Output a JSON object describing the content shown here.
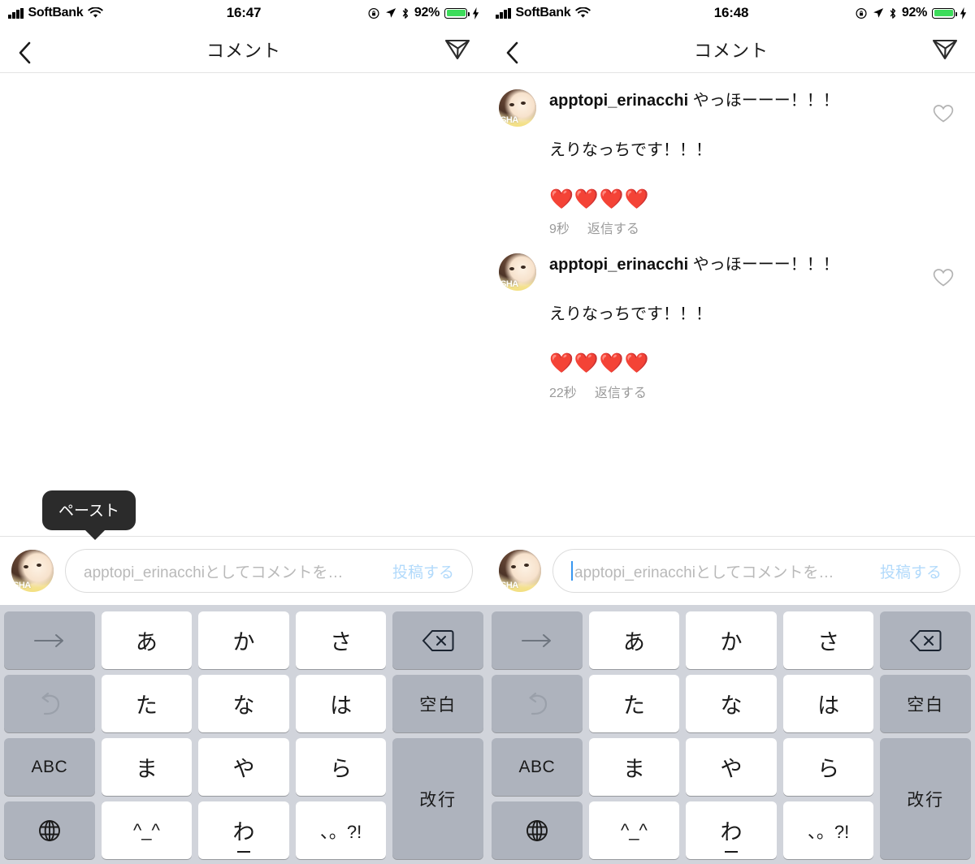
{
  "panels": [
    {
      "id": "left",
      "status": {
        "carrier": "SoftBank",
        "time": "16:47",
        "battery_pct": "92%"
      },
      "nav": {
        "title": "コメント",
        "back": "戻る",
        "share": "送信"
      },
      "feed": {
        "comments": []
      },
      "tooltip": {
        "label": "ペースト"
      },
      "input": {
        "placeholder": "apptopi_erinacchiとしてコメントを…",
        "value": "",
        "post_label": "投稿する",
        "caret": false
      }
    },
    {
      "id": "right",
      "status": {
        "carrier": "SoftBank",
        "time": "16:48",
        "battery_pct": "92%"
      },
      "nav": {
        "title": "コメント",
        "back": "戻る",
        "share": "送信"
      },
      "feed": {
        "comments": [
          {
            "username": "apptopi_erinacchi",
            "text": "やっほーーー！！！",
            "line2": "えりなっちです！！！",
            "hearts": "❤️❤️❤️❤️",
            "time": "9秒",
            "reply": "返信する",
            "avatar_badge": "SHA"
          },
          {
            "username": "apptopi_erinacchi",
            "text": "やっほーーー！！！",
            "line2": "えりなっちです！！！",
            "hearts": "❤️❤️❤️❤️",
            "time": "22秒",
            "reply": "返信する",
            "avatar_badge": "SHA"
          }
        ]
      },
      "tooltip": null,
      "input": {
        "placeholder": "apptopi_erinacchiとしてコメントを…",
        "value": "",
        "post_label": "投稿する",
        "caret": true
      }
    }
  ],
  "keyboard": {
    "keys": [
      {
        "label": "→",
        "style": "gray",
        "mod": "dim"
      },
      {
        "label": "あ",
        "style": "white",
        "mod": ""
      },
      {
        "label": "か",
        "style": "white",
        "mod": ""
      },
      {
        "label": "さ",
        "style": "white",
        "mod": ""
      },
      {
        "label": "⌫",
        "style": "gray",
        "mod": "icon-delete"
      },
      {
        "label": "↺",
        "style": "gray",
        "mod": "dim"
      },
      {
        "label": "た",
        "style": "white",
        "mod": ""
      },
      {
        "label": "な",
        "style": "white",
        "mod": ""
      },
      {
        "label": "は",
        "style": "white",
        "mod": ""
      },
      {
        "label": "空白",
        "style": "gray",
        "mod": "small"
      },
      {
        "label": "ABC",
        "style": "gray",
        "mod": "abc"
      },
      {
        "label": "ま",
        "style": "white",
        "mod": ""
      },
      {
        "label": "や",
        "style": "white",
        "mod": ""
      },
      {
        "label": "ら",
        "style": "white",
        "mod": ""
      },
      {
        "label": "改行",
        "style": "gray",
        "mod": "enter"
      },
      {
        "label": "🌐",
        "style": "gray",
        "mod": "icon-globe"
      },
      {
        "label": "^_^",
        "style": "white",
        "mod": "tiny"
      },
      {
        "label": "わ",
        "style": "white",
        "mod": "underscore"
      },
      {
        "label": "、。?!",
        "style": "white",
        "mod": "tiny"
      }
    ]
  },
  "colors": {
    "accent_blue": "#3897f0",
    "post_blue": "#b2dafb",
    "heart_red": "#ed2024",
    "battery_green": "#3ddc5b",
    "keyboard_bg": "#d1d4db",
    "key_gray": "#aeb3bd",
    "tooltip_bg": "#2b2b2b",
    "meta_gray": "#9a9a9a"
  }
}
